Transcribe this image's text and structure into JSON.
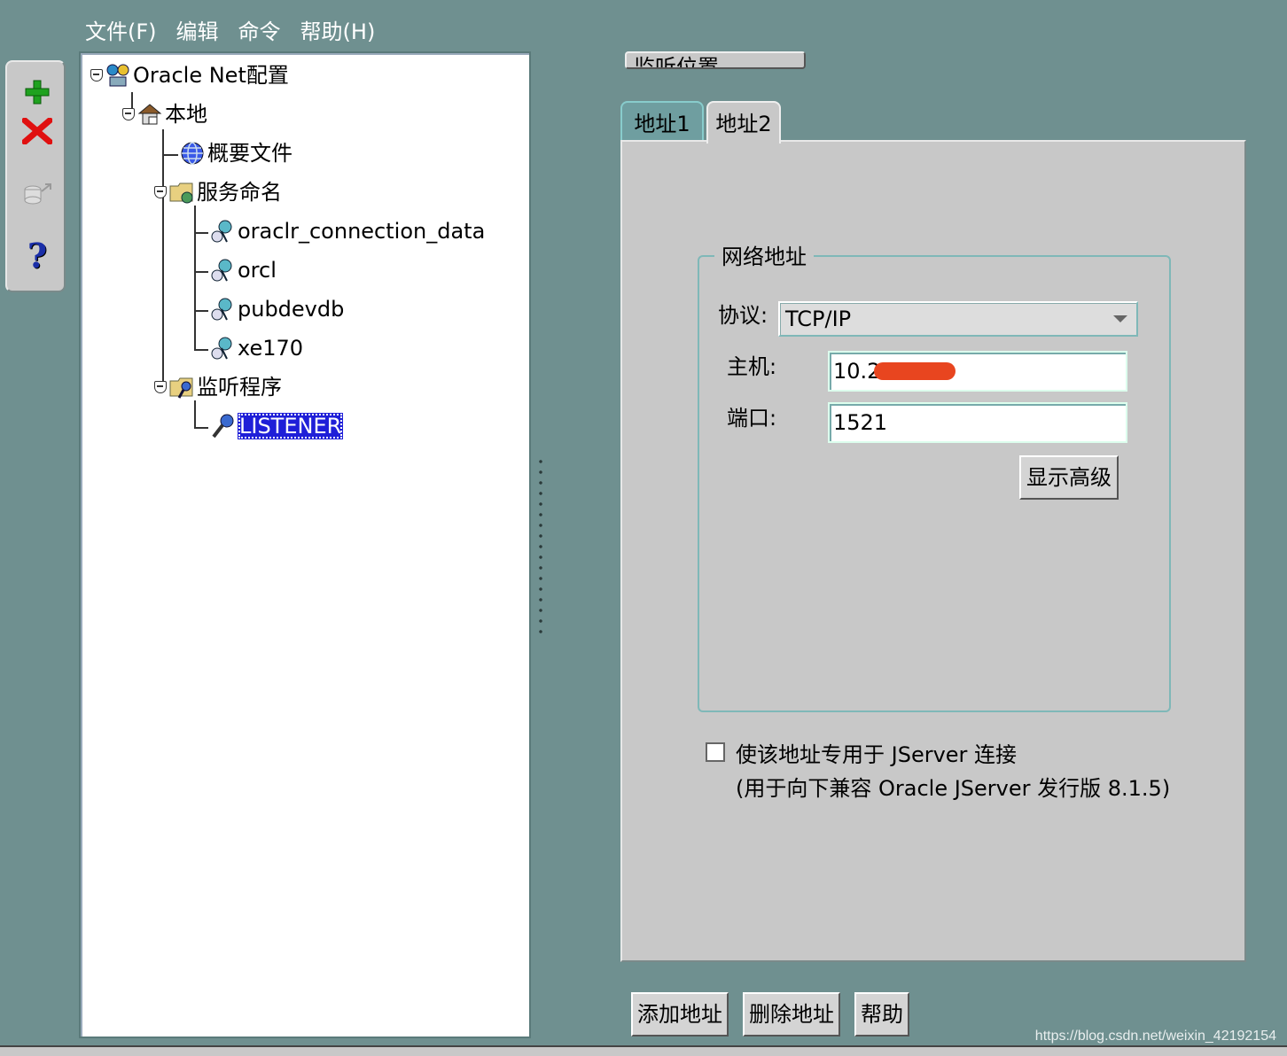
{
  "menu": [
    "文件(F)",
    "编辑",
    "命令",
    "帮助(H)"
  ],
  "toolbar": {
    "add_icon": "plus-icon",
    "delete_icon": "x-icon",
    "test_icon": "test-service-icon",
    "help_icon": "question-icon",
    "help_glyph": "?"
  },
  "tree": {
    "root": "Oracle Net配置",
    "local": "本地",
    "profile": "概要文件",
    "service_naming": "服务命名",
    "services": [
      "oraclr_connection_data",
      "orcl",
      "pubdevdb",
      "xe170"
    ],
    "listeners_folder": "监听程序",
    "listener": "LISTENER"
  },
  "top_button_label": "监听位置",
  "tabs": [
    "地址1",
    "地址2"
  ],
  "active_tab": "地址2",
  "network_address": {
    "title": "网络地址",
    "protocol_label": "协议:",
    "protocol_value": "TCP/IP",
    "host_label": "主机:",
    "host_value": "10.2",
    "port_label": "端口:",
    "port_value": "1521",
    "advanced_button": "显示高级"
  },
  "jserver": {
    "checkbox_label": "使该地址专用于 JServer 连接",
    "note": "(用于向下兼容 Oracle JServer 发行版 8.1.5)",
    "checked": false
  },
  "buttons": {
    "add_address": "添加地址",
    "remove_address": "删除地址",
    "help": "帮助"
  },
  "watermark": "https://blog.csdn.net/weixin_42192154",
  "colors": {
    "background": "#6f9090",
    "selection": "#1f1fd8",
    "panel": "#c8c8c8",
    "redaction": "#e8451f"
  }
}
